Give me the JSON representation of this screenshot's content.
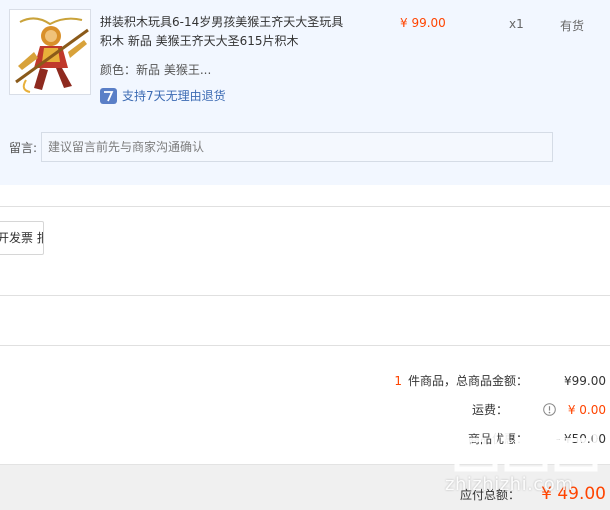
{
  "product": {
    "title": "拼装积木玩具6-14岁男孩美猴王齐天大圣玩具积木 新品 美猴王齐天大圣615片积木",
    "price": "¥ 99.00",
    "quantity": "x1",
    "stock_status": "有货",
    "sku_text": "颜色：新品 美猴王...",
    "service_text": "支持7天无理由退货",
    "service_icon": "return-7day-icon"
  },
  "memo": {
    "label": "留言:",
    "placeholder": "建议留言前先与商家沟通确认"
  },
  "invoice": {
    "button_label": "开发票 报销"
  },
  "summary": {
    "count": "1",
    "total_label": "件商品，总商品金额：",
    "total_value": "¥99.00",
    "shipping_label": "运费：",
    "shipping_value": "¥ 0.00",
    "discount_label": "商品优惠：",
    "discount_value": "- ¥50.00",
    "payable_label": "应付总额：",
    "payable_value": "¥ 49.00"
  },
  "watermark": {
    "text": "zhizhizhi.com",
    "icon": "zhizhizhi-logo"
  },
  "colors": {
    "accent": "#ff4400",
    "link": "#3c6bb3",
    "order_bg": "#f2f7ff",
    "footer_bg": "#f0f0f0"
  }
}
